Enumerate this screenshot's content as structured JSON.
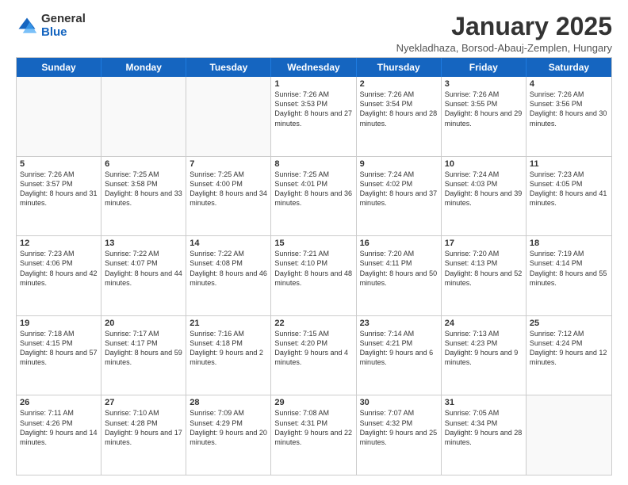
{
  "logo": {
    "general": "General",
    "blue": "Blue"
  },
  "header": {
    "title": "January 2025",
    "subtitle": "Nyekladhaza, Borsod-Abauj-Zemplen, Hungary"
  },
  "dayHeaders": [
    "Sunday",
    "Monday",
    "Tuesday",
    "Wednesday",
    "Thursday",
    "Friday",
    "Saturday"
  ],
  "weeks": [
    [
      {
        "day": "",
        "info": ""
      },
      {
        "day": "",
        "info": ""
      },
      {
        "day": "",
        "info": ""
      },
      {
        "day": "1",
        "info": "Sunrise: 7:26 AM\nSunset: 3:53 PM\nDaylight: 8 hours and 27 minutes."
      },
      {
        "day": "2",
        "info": "Sunrise: 7:26 AM\nSunset: 3:54 PM\nDaylight: 8 hours and 28 minutes."
      },
      {
        "day": "3",
        "info": "Sunrise: 7:26 AM\nSunset: 3:55 PM\nDaylight: 8 hours and 29 minutes."
      },
      {
        "day": "4",
        "info": "Sunrise: 7:26 AM\nSunset: 3:56 PM\nDaylight: 8 hours and 30 minutes."
      }
    ],
    [
      {
        "day": "5",
        "info": "Sunrise: 7:26 AM\nSunset: 3:57 PM\nDaylight: 8 hours and 31 minutes."
      },
      {
        "day": "6",
        "info": "Sunrise: 7:25 AM\nSunset: 3:58 PM\nDaylight: 8 hours and 33 minutes."
      },
      {
        "day": "7",
        "info": "Sunrise: 7:25 AM\nSunset: 4:00 PM\nDaylight: 8 hours and 34 minutes."
      },
      {
        "day": "8",
        "info": "Sunrise: 7:25 AM\nSunset: 4:01 PM\nDaylight: 8 hours and 36 minutes."
      },
      {
        "day": "9",
        "info": "Sunrise: 7:24 AM\nSunset: 4:02 PM\nDaylight: 8 hours and 37 minutes."
      },
      {
        "day": "10",
        "info": "Sunrise: 7:24 AM\nSunset: 4:03 PM\nDaylight: 8 hours and 39 minutes."
      },
      {
        "day": "11",
        "info": "Sunrise: 7:23 AM\nSunset: 4:05 PM\nDaylight: 8 hours and 41 minutes."
      }
    ],
    [
      {
        "day": "12",
        "info": "Sunrise: 7:23 AM\nSunset: 4:06 PM\nDaylight: 8 hours and 42 minutes."
      },
      {
        "day": "13",
        "info": "Sunrise: 7:22 AM\nSunset: 4:07 PM\nDaylight: 8 hours and 44 minutes."
      },
      {
        "day": "14",
        "info": "Sunrise: 7:22 AM\nSunset: 4:08 PM\nDaylight: 8 hours and 46 minutes."
      },
      {
        "day": "15",
        "info": "Sunrise: 7:21 AM\nSunset: 4:10 PM\nDaylight: 8 hours and 48 minutes."
      },
      {
        "day": "16",
        "info": "Sunrise: 7:20 AM\nSunset: 4:11 PM\nDaylight: 8 hours and 50 minutes."
      },
      {
        "day": "17",
        "info": "Sunrise: 7:20 AM\nSunset: 4:13 PM\nDaylight: 8 hours and 52 minutes."
      },
      {
        "day": "18",
        "info": "Sunrise: 7:19 AM\nSunset: 4:14 PM\nDaylight: 8 hours and 55 minutes."
      }
    ],
    [
      {
        "day": "19",
        "info": "Sunrise: 7:18 AM\nSunset: 4:15 PM\nDaylight: 8 hours and 57 minutes."
      },
      {
        "day": "20",
        "info": "Sunrise: 7:17 AM\nSunset: 4:17 PM\nDaylight: 8 hours and 59 minutes."
      },
      {
        "day": "21",
        "info": "Sunrise: 7:16 AM\nSunset: 4:18 PM\nDaylight: 9 hours and 2 minutes."
      },
      {
        "day": "22",
        "info": "Sunrise: 7:15 AM\nSunset: 4:20 PM\nDaylight: 9 hours and 4 minutes."
      },
      {
        "day": "23",
        "info": "Sunrise: 7:14 AM\nSunset: 4:21 PM\nDaylight: 9 hours and 6 minutes."
      },
      {
        "day": "24",
        "info": "Sunrise: 7:13 AM\nSunset: 4:23 PM\nDaylight: 9 hours and 9 minutes."
      },
      {
        "day": "25",
        "info": "Sunrise: 7:12 AM\nSunset: 4:24 PM\nDaylight: 9 hours and 12 minutes."
      }
    ],
    [
      {
        "day": "26",
        "info": "Sunrise: 7:11 AM\nSunset: 4:26 PM\nDaylight: 9 hours and 14 minutes."
      },
      {
        "day": "27",
        "info": "Sunrise: 7:10 AM\nSunset: 4:28 PM\nDaylight: 9 hours and 17 minutes."
      },
      {
        "day": "28",
        "info": "Sunrise: 7:09 AM\nSunset: 4:29 PM\nDaylight: 9 hours and 20 minutes."
      },
      {
        "day": "29",
        "info": "Sunrise: 7:08 AM\nSunset: 4:31 PM\nDaylight: 9 hours and 22 minutes."
      },
      {
        "day": "30",
        "info": "Sunrise: 7:07 AM\nSunset: 4:32 PM\nDaylight: 9 hours and 25 minutes."
      },
      {
        "day": "31",
        "info": "Sunrise: 7:05 AM\nSunset: 4:34 PM\nDaylight: 9 hours and 28 minutes."
      },
      {
        "day": "",
        "info": ""
      }
    ]
  ]
}
